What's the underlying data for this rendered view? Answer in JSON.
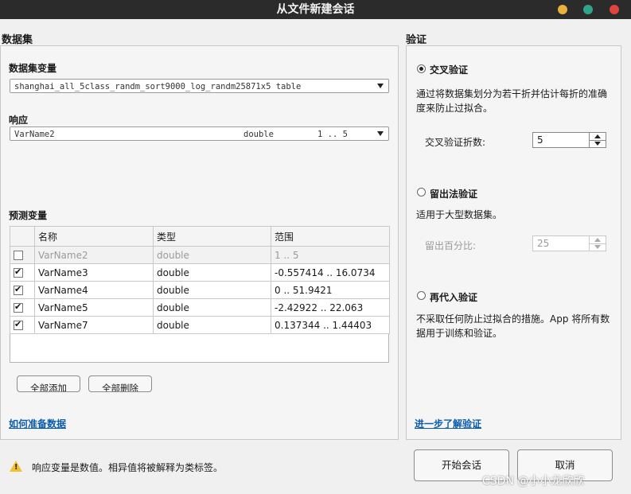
{
  "window": {
    "title": "从文件新建会话",
    "colors": {
      "yellow": "#e8b13a",
      "green": "#2ea58a",
      "red": "#e0443c"
    }
  },
  "dataset": {
    "section_title": "数据集",
    "variable_label": "数据集变量",
    "variable_value": "shanghai_all_5class_randm_sort9000_log_randm25871x5 table",
    "response_label": "响应",
    "response": {
      "name": "VarName2",
      "type": "double",
      "range": "1 .. 5"
    },
    "predictors_label": "预测变量",
    "columns": [
      "名称",
      "类型",
      "范围"
    ],
    "rows": [
      {
        "checked": false,
        "disabled": true,
        "name": "VarName2",
        "type": "double",
        "range": "1 .. 5"
      },
      {
        "checked": true,
        "disabled": false,
        "name": "VarName3",
        "type": "double",
        "range": "-0.557414 .. 16.0734"
      },
      {
        "checked": true,
        "disabled": false,
        "name": "VarName4",
        "type": "double",
        "range": "0 .. 51.9421"
      },
      {
        "checked": true,
        "disabled": false,
        "name": "VarName5",
        "type": "double",
        "range": "-2.42922 .. 22.063"
      },
      {
        "checked": true,
        "disabled": false,
        "name": "VarName7",
        "type": "double",
        "range": "0.137344 .. 1.44403"
      }
    ],
    "add_all": "全部添加",
    "remove_all": "全部删除",
    "help_link": "如何准备数据"
  },
  "validation": {
    "section_title": "验证",
    "cross": {
      "label": "交叉验证",
      "selected": true,
      "description": "通过将数据集划分为若干折并估计每折的准确度来防止过拟合。",
      "folds_label": "交叉验证折数:",
      "folds_value": "5"
    },
    "holdout": {
      "label": "留出法验证",
      "selected": false,
      "description": "适用于大型数据集。",
      "percent_label": "留出百分比:",
      "percent_value": "25"
    },
    "resub": {
      "label": "再代入验证",
      "selected": false,
      "description": "不采取任何防止过拟合的措施。App 将所有数据用于训练和验证。"
    },
    "learn_more": "进一步了解验证"
  },
  "footer": {
    "warning": "响应变量是数值。相异值将被解释为类标签。",
    "start_button": "开始会话",
    "cancel_button": "取消",
    "watermark": "CSDN @小小龙欣欣"
  }
}
